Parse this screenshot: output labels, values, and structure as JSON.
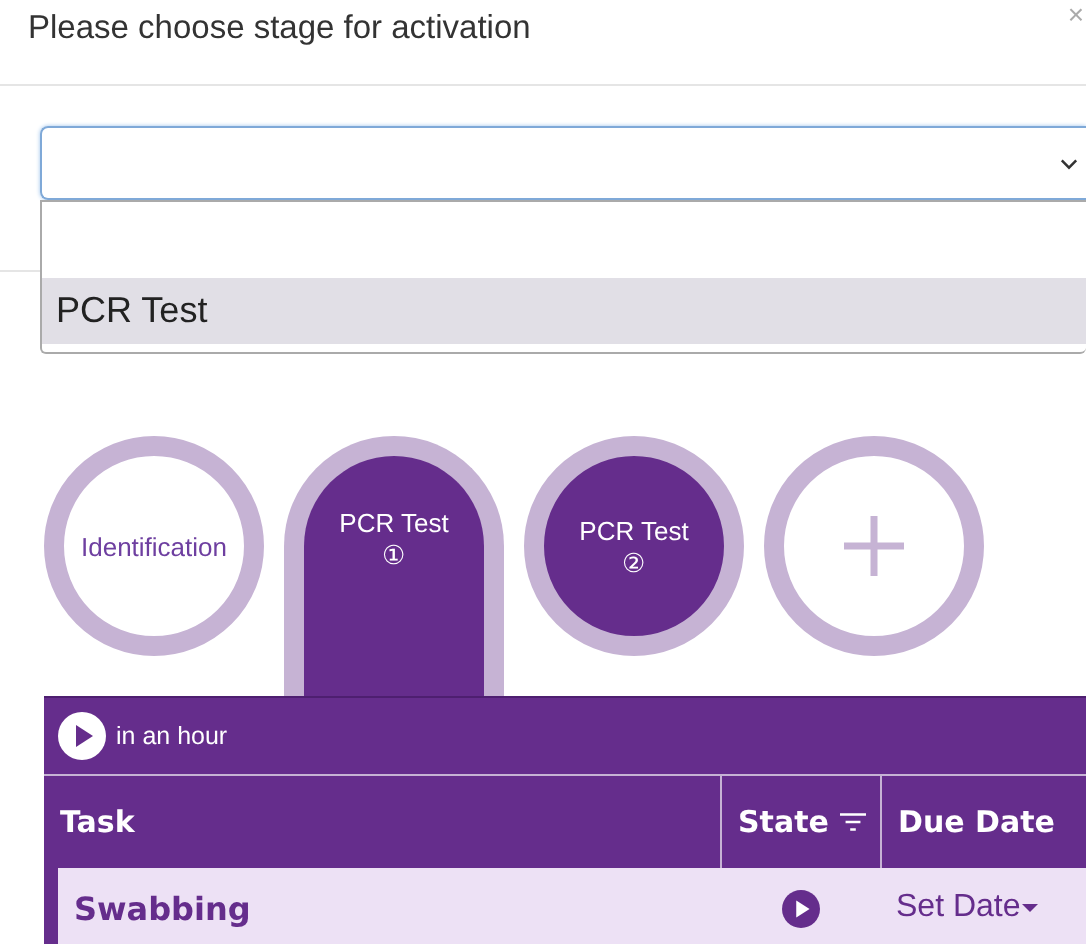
{
  "dialog": {
    "title": "Please choose stage for activation",
    "close": "×"
  },
  "stage_select": {
    "options": [
      {
        "kind": "option",
        "label": "PCR Test",
        "highlighted": true
      }
    ]
  },
  "stages": [
    {
      "kind": "stage",
      "label": "Identification",
      "filled": false,
      "selected": false
    },
    {
      "kind": "stage",
      "label": "PCR Test",
      "number": "①",
      "filled": true,
      "selected": true
    },
    {
      "kind": "stage",
      "label": "PCR Test",
      "number": "②",
      "filled": true,
      "selected": false
    },
    {
      "kind": "add"
    }
  ],
  "schedule": {
    "label": "in an hour"
  },
  "table": {
    "columns": [
      {
        "label": "Task",
        "filter": false
      },
      {
        "label": "State",
        "filter": true
      },
      {
        "label": "Due Date",
        "filter": false
      }
    ],
    "rows": [
      {
        "task": "Swabbing",
        "due": "Set Date"
      }
    ]
  }
}
